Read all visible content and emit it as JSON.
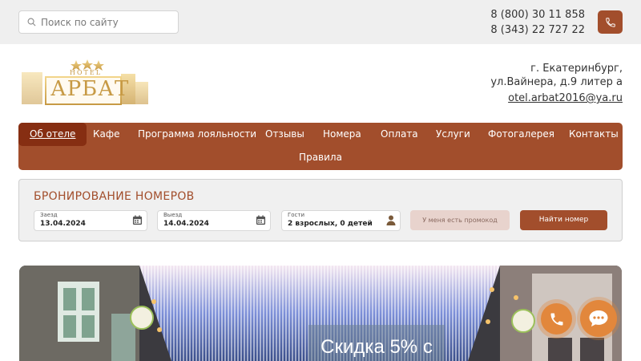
{
  "search": {
    "placeholder": "Поиск по сайту"
  },
  "contacts": {
    "phone1": "8 (800) 30 11 858",
    "phone2": "8 (343) 22 727 22"
  },
  "logo": {
    "small_text": "HOTEL",
    "main_text": "АРБАТ"
  },
  "address": {
    "line1": "г. Екатеринбург,",
    "line2": "ул.Вайнера, д.9 литер а",
    "email": "otel.arbat2016@ya.ru"
  },
  "nav": {
    "items": [
      "Об отеле",
      "Кафе",
      "Программа лояльности",
      "Отзывы",
      "Номера",
      "Оплата",
      "Услуги",
      "Фотогалерея",
      "Контакты"
    ],
    "second_row": [
      "Правила"
    ],
    "active": "Об отеле"
  },
  "booking": {
    "title": "БРОНИРОВАНИЕ НОМЕРОВ",
    "checkin": {
      "label": "Заезд",
      "value": "13.04.2024"
    },
    "checkout": {
      "label": "Выезд",
      "value": "14.04.2024"
    },
    "guests": {
      "label": "Гости",
      "value": "2 взрослых, 0 детей"
    },
    "promo_label": "У меня есть промокод",
    "find_label": "Найти номер"
  },
  "hero": {
    "title": "Скидка 5% с"
  },
  "colors": {
    "accent": "#a24e2c",
    "accent_dark": "#862e12",
    "float": "#e2873c"
  },
  "icons": {
    "search": "search-icon",
    "phone": "phone-icon",
    "calendar": "calendar-icon",
    "person": "person-icon",
    "chat": "chat-icon"
  }
}
